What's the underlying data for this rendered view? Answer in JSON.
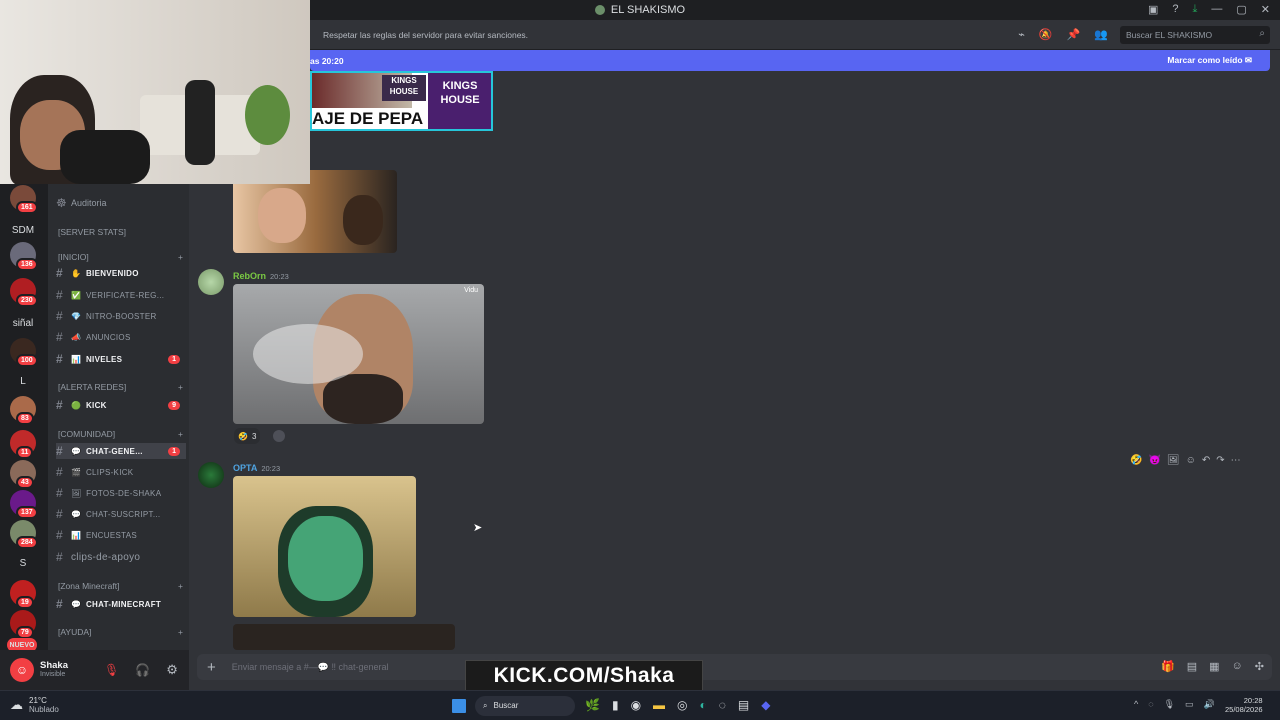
{
  "window": {
    "title": "EL SHAKISMO"
  },
  "topbar": {
    "topic": "Respetar las reglas del servidor para evitar sanciones.",
    "search_placeholder": "Buscar EL SHAKISMO"
  },
  "new_messages_bar": {
    "text": "as 20:20",
    "action": "Marcar como leído"
  },
  "servers": [
    {
      "label": "",
      "badge": "161"
    },
    {
      "label": "SDM",
      "badge": ""
    },
    {
      "label": "",
      "badge": "136"
    },
    {
      "label": "",
      "badge": "230"
    },
    {
      "label": "siñal",
      "badge": ""
    },
    {
      "label": "",
      "badge": "100"
    },
    {
      "label": "L",
      "badge": ""
    },
    {
      "label": "",
      "badge": "83"
    },
    {
      "label": "",
      "badge": "11"
    },
    {
      "label": "",
      "badge": "43"
    },
    {
      "label": "",
      "badge": "137"
    },
    {
      "label": "",
      "badge": "284"
    },
    {
      "label": "S",
      "badge": ""
    },
    {
      "label": "",
      "badge": "19"
    },
    {
      "label": "",
      "badge": "79"
    },
    {
      "label": "NUEVO",
      "badge": ""
    }
  ],
  "channels": {
    "audit": "Auditoria",
    "categories": [
      "[SERVER STATS]",
      "[INICIO]",
      "[ALERTA REDES]",
      "[COMUNIDAD]",
      "[Zona Minecraft]",
      "[AYUDA]"
    ],
    "items": [
      {
        "name": "bienvenido",
        "badge": ""
      },
      {
        "name": "verificate-reg...",
        "badge": ""
      },
      {
        "name": "nitro-booster",
        "badge": ""
      },
      {
        "name": "anuncios",
        "badge": ""
      },
      {
        "name": "niveles",
        "badge": "1"
      },
      {
        "name": "kick",
        "badge": "9"
      },
      {
        "name": "chat-gene...",
        "badge": "1"
      },
      {
        "name": "clips-kick",
        "badge": ""
      },
      {
        "name": "fotos-de-shaka",
        "badge": ""
      },
      {
        "name": "chat-suscript...",
        "badge": ""
      },
      {
        "name": "encuestas",
        "badge": ""
      },
      {
        "name": "clips-de-apoyo",
        "badge": ""
      },
      {
        "name": "chat-minecraft",
        "badge": ""
      }
    ]
  },
  "user": {
    "name": "Shaka",
    "status": "Invisible"
  },
  "messages": [
    {
      "author": "RebOrn",
      "time": "20:23",
      "image_tag": "Vidu",
      "reaction_count": "3"
    },
    {
      "author": "OPTA",
      "time": "20:23"
    }
  ],
  "banner_text": {
    "line1": "KINGS",
    "line2": "HOUSE",
    "line3": "AJE DE PEPA",
    "small": "KINGS HOUSE"
  },
  "composer": {
    "placeholder": "Enviar mensaje a #—💬 ‼ chat-general"
  },
  "overlay": {
    "kick": "KICK.COM/Shaka"
  },
  "taskbar": {
    "temp": "21°C",
    "weather": "Nublado",
    "search": "Buscar",
    "time": "20:28",
    "date": "25/08/2026"
  },
  "colors": {
    "accent": "#5865f2",
    "danger": "#f23f43",
    "online": "#23a55a"
  }
}
